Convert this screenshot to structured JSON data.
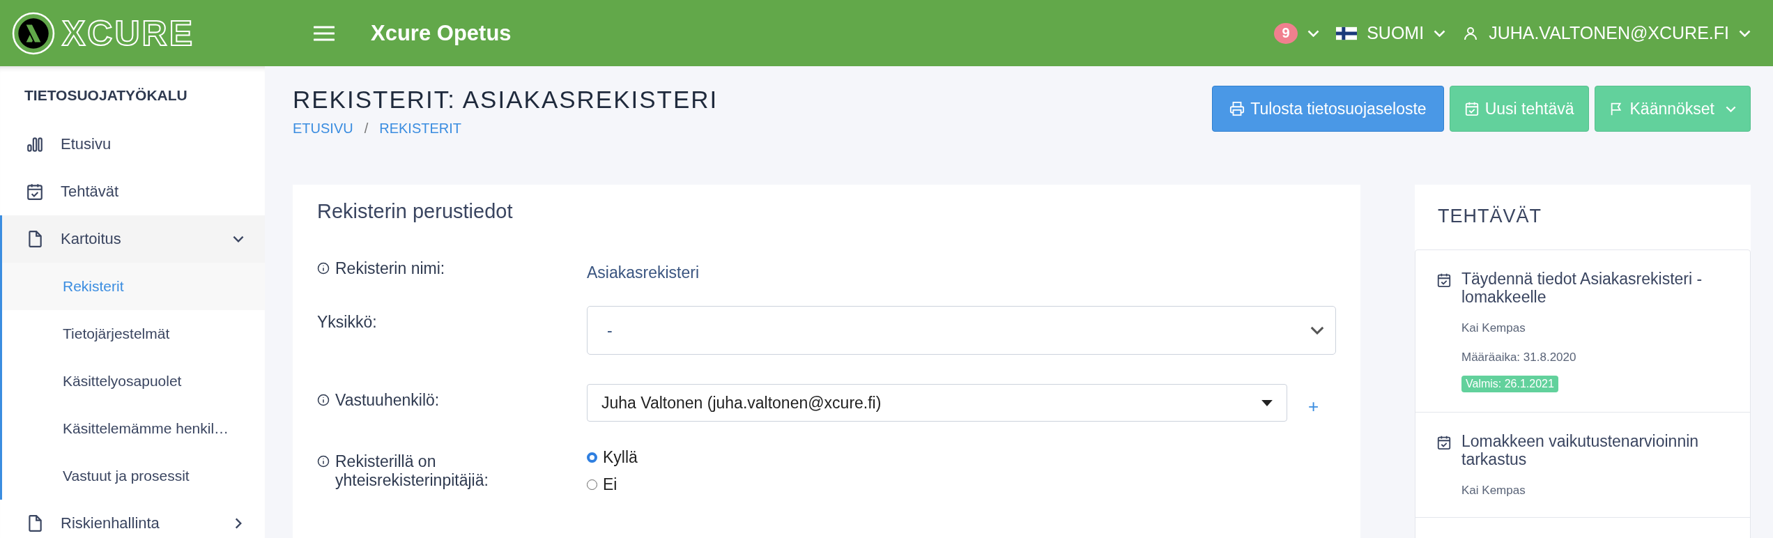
{
  "header": {
    "logo_text": "XCURE",
    "app_title": "Xcure Opetus",
    "notifications": "9",
    "language": "SUOMI",
    "user": "JUHA.VALTONEN@XCURE.FI"
  },
  "sidebar": {
    "heading": "TIETOSUOJATYÖKALU",
    "items": [
      {
        "label": "Etusivu",
        "selected": false
      },
      {
        "label": "Tehtävät",
        "selected": false
      },
      {
        "label": "Kartoitus",
        "selected": false,
        "expanded": true,
        "children": [
          {
            "label": "Rekisterit",
            "selected": true
          },
          {
            "label": "Tietojärjestelmät",
            "selected": false
          },
          {
            "label": "Käsittelyosapuolet",
            "selected": false
          },
          {
            "label": "Käsittelemämme henkil…",
            "selected": false
          },
          {
            "label": "Vastuut ja prosessit",
            "selected": false
          }
        ]
      },
      {
        "label": "Riskienhallinta",
        "selected": false,
        "expanded": false
      }
    ]
  },
  "page": {
    "title": "REKISTERIT: ASIAKASREKISTERI",
    "breadcrumbs": [
      "ETUSIVU",
      "REKISTERIT"
    ],
    "breadcrumb_separator": "/",
    "buttons": [
      {
        "label": "Tulosta tietosuojaseloste",
        "menu": false
      },
      {
        "label": "Uusi tehtävä",
        "menu": false
      },
      {
        "label": "Käännökset",
        "menu": true
      }
    ]
  },
  "form": {
    "title": "Rekisterin perustiedot",
    "fields": [
      {
        "kind": "text",
        "label": "Rekisterin nimi:",
        "info": true,
        "value": "Asiakasrekisteri"
      },
      {
        "kind": "select",
        "label": "Yksikkö:",
        "info": false,
        "value": "-"
      },
      {
        "kind": "combo",
        "label": "Vastuuhenkilö:",
        "info": true,
        "value": "Juha Valtonen (juha.valtonen@xcure.fi)",
        "add_label": "+"
      },
      {
        "kind": "radio",
        "label": "Rekisterillä on yhteisrekisterinpitäjiä:",
        "info": true,
        "options": [
          {
            "label": "Kyllä",
            "selected": true
          },
          {
            "label": "Ei",
            "selected": false
          }
        ]
      }
    ]
  },
  "tasks": {
    "heading": "TEHTÄVÄT",
    "items": [
      {
        "title": "Täydennä tiedot Asiakasrekisteri -lomakkeelle",
        "assignee": "Kai Kempas",
        "deadline": "Määräaika: 31.8.2020",
        "status": "Valmis: 26.1.2021"
      },
      {
        "title": "Lomakkeen vaikutustenarvioinnin tarkastus",
        "assignee": "Kai Kempas"
      }
    ]
  }
}
